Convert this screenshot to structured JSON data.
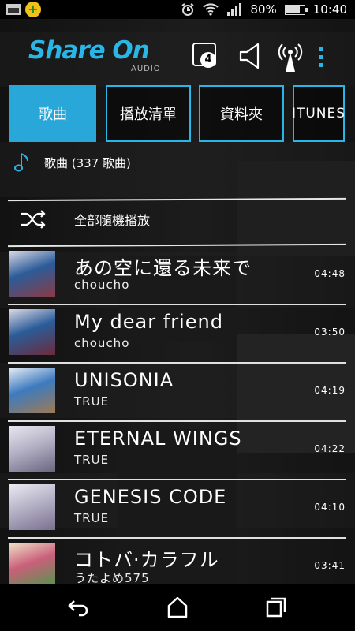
{
  "status_bar": {
    "battery": "80%",
    "battery_level": 0.8,
    "time": "10:40",
    "icons": [
      "gallery-icon",
      "plus-app-icon",
      "alarm-icon",
      "wifi-icon",
      "signal-icon",
      "battery-icon"
    ]
  },
  "header": {
    "logo": "Share On",
    "logo_sub": "AUDIO",
    "device_count": "4",
    "accent": "#29b6e6"
  },
  "tabs": [
    {
      "label": "歌曲",
      "active": true
    },
    {
      "label": "播放清單",
      "active": false
    },
    {
      "label": "資料夾",
      "active": false
    },
    {
      "label": "ITUNES",
      "active": false
    }
  ],
  "section": {
    "label": "歌曲 (337 歌曲)"
  },
  "shuffle": {
    "label": "全部隨機播放"
  },
  "songs": [
    {
      "title": "あの空に還る未来で",
      "artist": "choucho",
      "duration": "04:48"
    },
    {
      "title": "My dear friend",
      "artist": "choucho",
      "duration": "03:50"
    },
    {
      "title": "UNISONIA",
      "artist": "TRUE",
      "duration": "04:19"
    },
    {
      "title": "ETERNAL WINGS",
      "artist": "TRUE",
      "duration": "04:22"
    },
    {
      "title": "GENESIS CODE",
      "artist": "TRUE",
      "duration": "04:10"
    },
    {
      "title": "コトバ·カラフル",
      "artist": "うたよめ575",
      "duration": "03:41"
    }
  ],
  "nav": {
    "icons": [
      "back-icon",
      "home-icon",
      "recents-icon"
    ]
  }
}
